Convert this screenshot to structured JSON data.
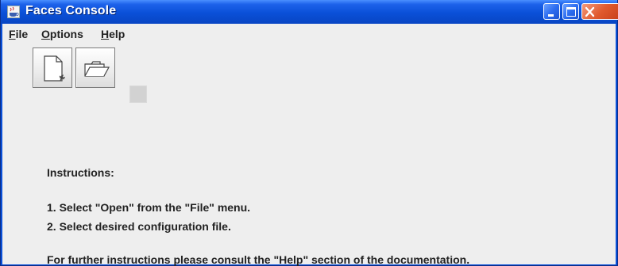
{
  "window": {
    "title": "Faces Console",
    "app_icon": "java-cup-icon",
    "controls": {
      "minimize": "minimize-icon",
      "maximize": "maximize-icon",
      "close": "close-icon"
    }
  },
  "menubar": {
    "items": [
      {
        "label": "File",
        "mnemonic": "F",
        "rest": "ile"
      },
      {
        "label": "Options",
        "mnemonic": "O",
        "rest": "ptions"
      },
      {
        "label": "Help",
        "mnemonic": "H",
        "rest": "elp"
      }
    ]
  },
  "toolbar": {
    "buttons": [
      {
        "icon": "new-file-icon",
        "enabled": true
      },
      {
        "icon": "open-folder-icon",
        "enabled": true
      },
      {
        "icon": "save-icon",
        "enabled": false
      }
    ]
  },
  "instructions": {
    "heading": "Instructions:",
    "steps": [
      "1.  Select \"Open\" from the \"File\" menu.",
      "2.  Select desired configuration file."
    ],
    "footer": "For further instructions please consult the \"Help\" section of the documentation."
  }
}
